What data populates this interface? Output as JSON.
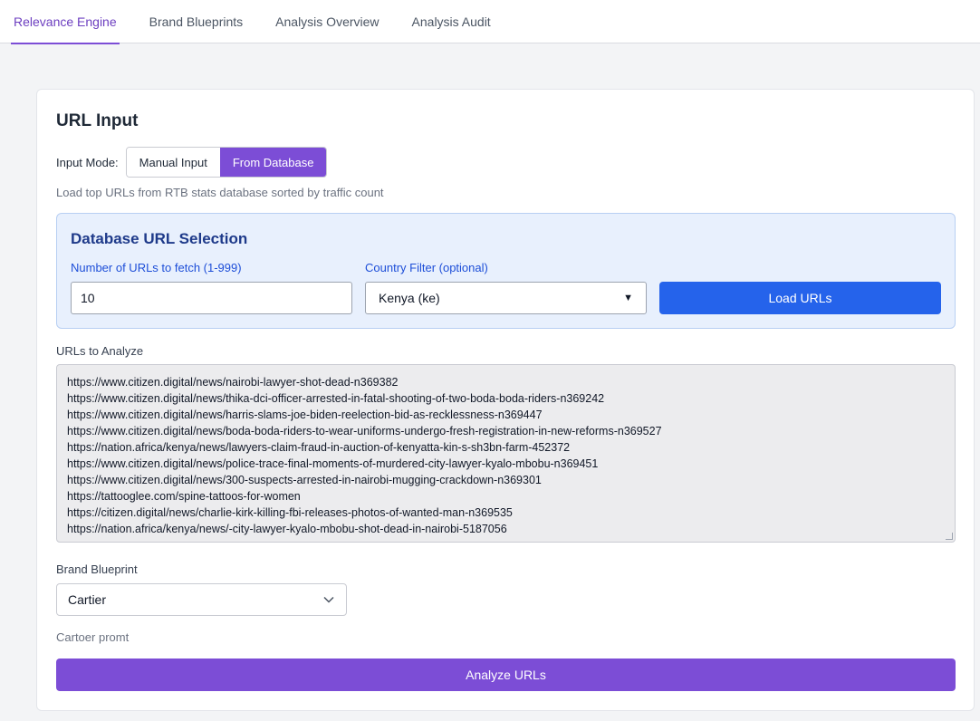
{
  "tabs": [
    {
      "label": "Relevance Engine",
      "active": true
    },
    {
      "label": "Brand Blueprints",
      "active": false
    },
    {
      "label": "Analysis Overview",
      "active": false
    },
    {
      "label": "Analysis Audit",
      "active": false
    }
  ],
  "url_input": {
    "title": "URL Input",
    "mode_label": "Input Mode:",
    "modes": [
      "Manual Input",
      "From Database"
    ],
    "selected_mode": "From Database",
    "help_text": "Load top URLs from RTB stats database sorted by traffic count"
  },
  "database": {
    "title": "Database URL Selection",
    "count_label": "Number of URLs to fetch (1-999)",
    "count_value": "10",
    "country_label": "Country Filter (optional)",
    "country_value": "Kenya (ke)",
    "load_button": "Load URLs"
  },
  "urls": {
    "label": "URLs to Analyze",
    "items": [
      "https://www.citizen.digital/news/nairobi-lawyer-shot-dead-n369382",
      "https://www.citizen.digital/news/thika-dci-officer-arrested-in-fatal-shooting-of-two-boda-boda-riders-n369242",
      "https://www.citizen.digital/news/harris-slams-joe-biden-reelection-bid-as-recklessness-n369447",
      "https://www.citizen.digital/news/boda-boda-riders-to-wear-uniforms-undergo-fresh-registration-in-new-reforms-n369527",
      "https://nation.africa/kenya/news/lawyers-claim-fraud-in-auction-of-kenyatta-kin-s-sh3bn-farm-452372",
      "https://www.citizen.digital/news/police-trace-final-moments-of-murdered-city-lawyer-kyalo-mbobu-n369451",
      "https://www.citizen.digital/news/300-suspects-arrested-in-nairobi-mugging-crackdown-n369301",
      "https://tattooglee.com/spine-tattoos-for-women",
      "https://citizen.digital/news/charlie-kirk-killing-fbi-releases-photos-of-wanted-man-n369535",
      "https://nation.africa/kenya/news/-city-lawyer-kyalo-mbobu-shot-dead-in-nairobi-5187056"
    ]
  },
  "blueprint": {
    "label": "Brand Blueprint",
    "value": "Cartier",
    "description": "Cartoer promt"
  },
  "analyze_button": "Analyze URLs"
}
